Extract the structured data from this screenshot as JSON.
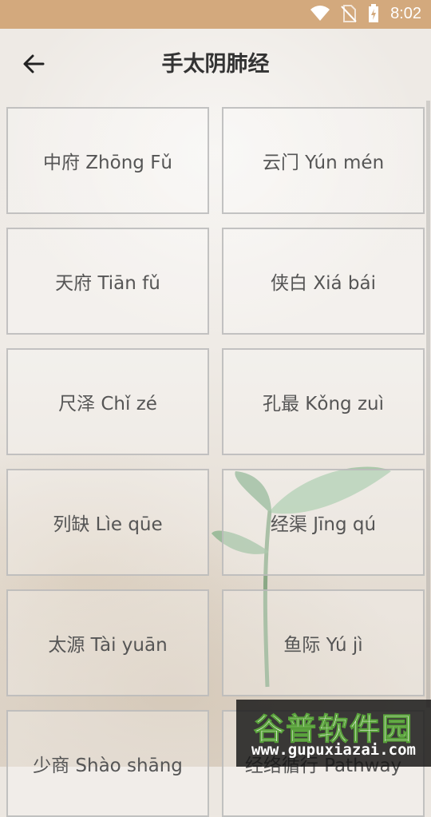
{
  "status": {
    "time": "8:02"
  },
  "header": {
    "title": "手太阴肺经",
    "back_icon": "arrow-left-icon"
  },
  "acupoints": [
    "中府 Zhōng Fǔ",
    "云门 Yún mén",
    "天府 Tiān fǔ",
    "侠白 Xiá bái",
    "尺泽 Chǐ zé",
    "孔最 Kǒng zuì",
    "列缺 Lìe qūe",
    "经渠 Jīng qú",
    "太源 Tài yuān",
    "鱼际 Yú jì",
    "少商 Shào shāng",
    "经络循行 Pathway"
  ],
  "watermark": {
    "name": "谷普软件园",
    "url": "www.gupuxiazai.com"
  },
  "colors": {
    "statusbar": "#d3a97d",
    "title": "#333333",
    "cell_border": "#b9b9b9"
  }
}
